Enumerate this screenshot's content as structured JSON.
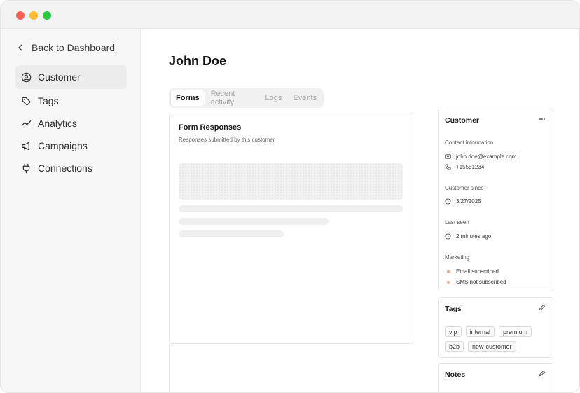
{
  "sidebar": {
    "back_label": "Back to Dashboard",
    "items": [
      {
        "label": "Customer",
        "icon": "user-circle-icon",
        "active": true
      },
      {
        "label": "Tags",
        "icon": "tag-icon",
        "active": false
      },
      {
        "label": "Analytics",
        "icon": "trend-line-icon",
        "active": false
      },
      {
        "label": "Campaigns",
        "icon": "megaphone-icon",
        "active": false
      },
      {
        "label": "Connections",
        "icon": "plug-icon",
        "active": false
      }
    ]
  },
  "main": {
    "title": "John Doe",
    "tabs": [
      {
        "label": "Forms",
        "active": true
      },
      {
        "label": "Recent activity",
        "active": false
      },
      {
        "label": "Logs",
        "active": false
      },
      {
        "label": "Events",
        "active": false
      }
    ],
    "forms": {
      "title": "Form Responses",
      "subtitle": "Responses submitted by this customer"
    }
  },
  "customer_card": {
    "title": "Customer",
    "menu_icon": "more-horizontal-icon",
    "contact_label": "Contact information",
    "email": "john.doe@example.com",
    "phone": "+15551234",
    "since_label": "Customer since",
    "since_value": "3/27/2025",
    "last_seen_label": "Last seen",
    "last_seen_value": "2 minutes ago",
    "marketing_label": "Marketing",
    "marketing": [
      "Email subscribed",
      "SMS not subscribed"
    ],
    "status_color": "#f0a48c"
  },
  "tags_card": {
    "title": "Tags",
    "edit_icon": "pencil-icon",
    "tags": [
      "vip",
      "internal",
      "premium",
      "b2b",
      "new-customer"
    ]
  },
  "notes_card": {
    "title": "Notes",
    "edit_icon": "pencil-icon"
  },
  "colors": {
    "sidebar_bg": "#f7f7f7",
    "active_item_bg": "#ececec",
    "window_close": "#ff5f57",
    "window_minimize": "#febc2e",
    "window_zoom": "#28c840"
  }
}
